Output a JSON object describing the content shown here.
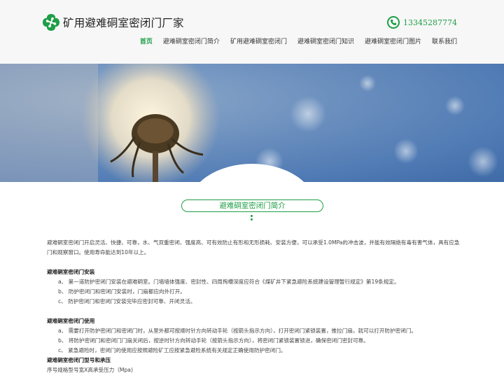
{
  "header": {
    "company_name": "矿用避难硐室密闭门厂家",
    "phone": "13345287774",
    "nav": [
      "首页",
      "避难硐室密闭门简介",
      "矿用避难硐室密闭门",
      "避难硐室密闭门知识",
      "避难硐室密闭门图片",
      "联系我们"
    ]
  },
  "section": {
    "title": "避难硐室密闭门简介"
  },
  "content": {
    "intro": "避难硐室密闭门开启灵活、快捷、可靠，水、气双重密闭、强度高、可有效防止有形和无形损耗、安装方便，可以承受1.0MPa的冲击波，并能有效隔绝有毒有害气体，具有应急门和观察窗口。使用寿命能达到10年以上。",
    "install_title": "避难硐室密闭门安装",
    "install_items": [
      "a、 第一道防护密闭门安装在避难硐室。门墙墙体强度、密封性、四周掏槽深度应符合《煤矿井下紧急避险系统建设管理暂行规定》第19条规定。",
      "b、 防护密闭门和密闭门安装时，门扇都应向外打开。",
      "c、 防护密闭门和密闭门安装完毕应密封可靠、开闭灵活。"
    ],
    "use_title": "避难硐室密闭门使用",
    "use_items": [
      "a、 需要打开防护密闭门和密闭门时，从里外都可按顺时针方向转动手轮（按箭头指示方向），打开密闭门紧锁装置，推拉门扇，就可以打开防护密闭门。",
      "b、 将防护密闭门和密闭门门扇关闭后，按逆时针方向转动手轮（按箭头指示方向），将密闭门紧锁装置锁进，确保密闭门密封可靠。",
      "c、 紧急避险时，密闭门的使用应按照避险矿工应按紧急避险系统有关规定正确使用防护密闭门。"
    ],
    "spec_title": "避难硐室密闭门型号和承压",
    "spec_header": "序号规格型号宽X高承受压力（Mpa)"
  },
  "colors": {
    "accent": "#1e9e46",
    "header_bg": "#f7f7f7"
  },
  "icons": {
    "logo": "clover-logo-icon",
    "phone": "phone-icon"
  }
}
